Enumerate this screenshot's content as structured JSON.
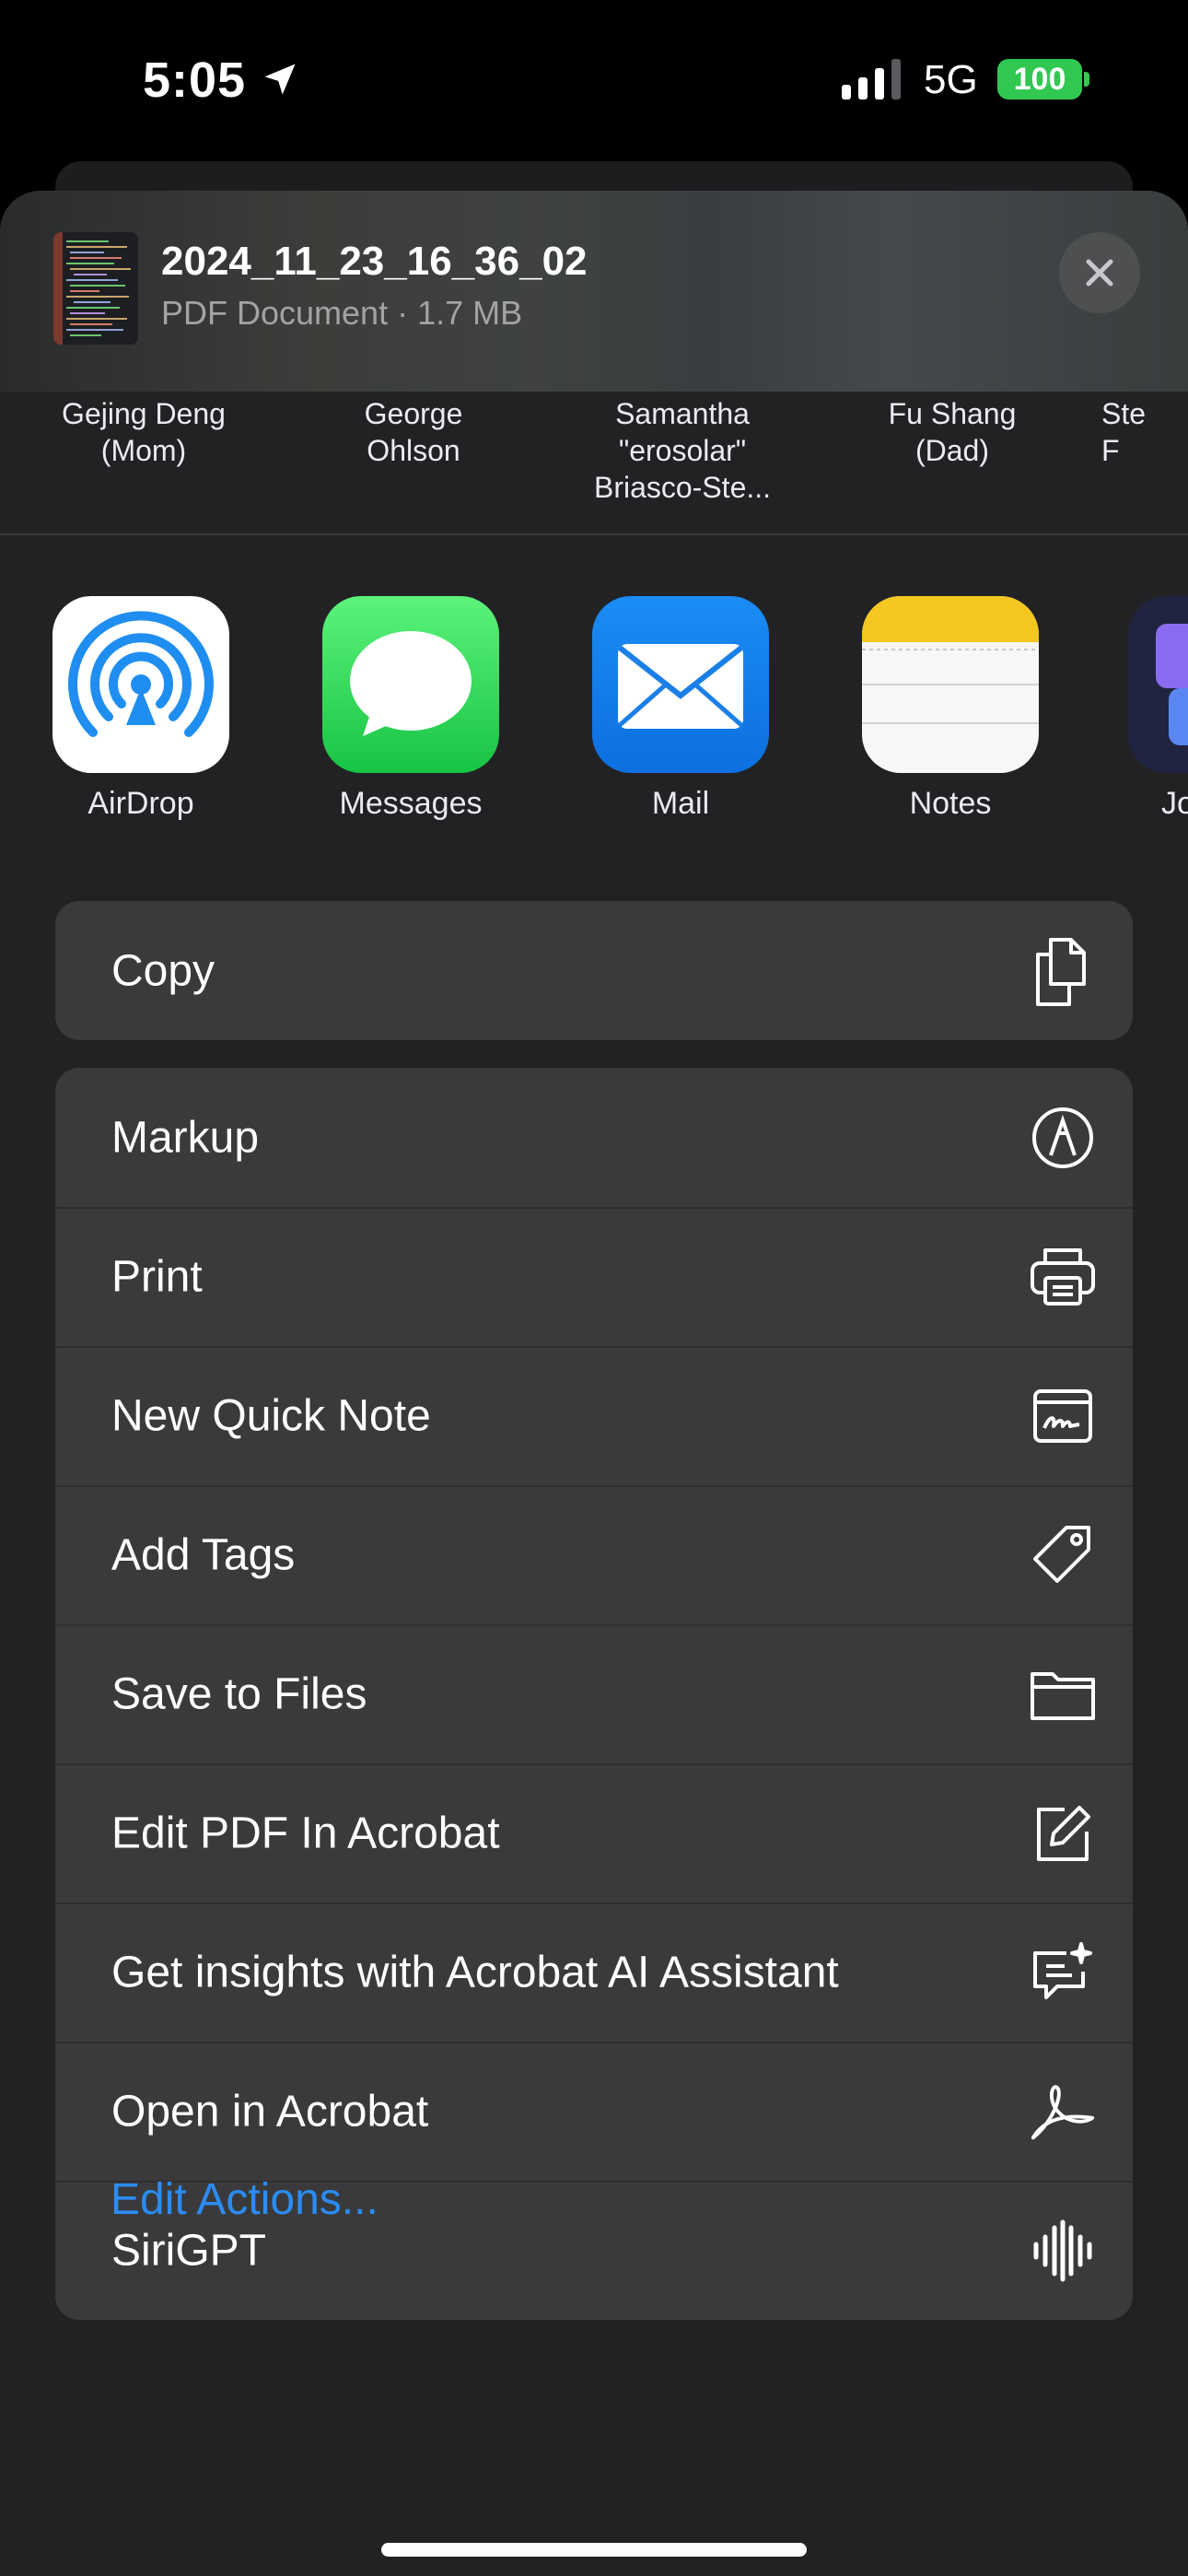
{
  "status_bar": {
    "time": "5:05",
    "network": "5G",
    "battery": "100"
  },
  "document": {
    "title": "2024_11_23_16_36_02",
    "subtitle": "PDF Document · 1.7 MB"
  },
  "contacts": [
    {
      "name": "Gejing Deng\n(Mom)"
    },
    {
      "name": "George\nOhlson"
    },
    {
      "name": "Samantha\n\"erosolar\"\nBriasco-Ste..."
    },
    {
      "name": "Fu  Shang\n(Dad)"
    },
    {
      "name": "Ste\nF"
    }
  ],
  "apps": [
    {
      "label": "AirDrop",
      "icon": "airdrop-icon"
    },
    {
      "label": "Messages",
      "icon": "messages-icon"
    },
    {
      "label": "Mail",
      "icon": "mail-icon"
    },
    {
      "label": "Notes",
      "icon": "notes-icon"
    },
    {
      "label": "Jo",
      "icon": "journal-icon"
    }
  ],
  "actions_primary": [
    {
      "label": "Copy",
      "icon": "copy-icon"
    }
  ],
  "actions": [
    {
      "label": "Markup",
      "icon": "markup-icon"
    },
    {
      "label": "Print",
      "icon": "printer-icon"
    },
    {
      "label": "New Quick Note",
      "icon": "quick-note-icon"
    },
    {
      "label": "Add Tags",
      "icon": "tag-icon"
    },
    {
      "label": "Save to Files",
      "icon": "folder-icon"
    },
    {
      "label": "Edit PDF In Acrobat",
      "icon": "edit-pencil-icon"
    },
    {
      "label": "Get insights with Acrobat AI Assistant",
      "icon": "ai-sparkle-chat-icon"
    },
    {
      "label": "Open in Acrobat",
      "icon": "acrobat-icon"
    },
    {
      "label": "SiriGPT",
      "icon": "waveform-icon"
    }
  ],
  "edit_actions_label": "Edit Actions...",
  "colors": {
    "accent": "#2b8cf2",
    "battery": "#31c852",
    "row_bg": "#3a3a3c",
    "sheet_bg": "#222224"
  }
}
